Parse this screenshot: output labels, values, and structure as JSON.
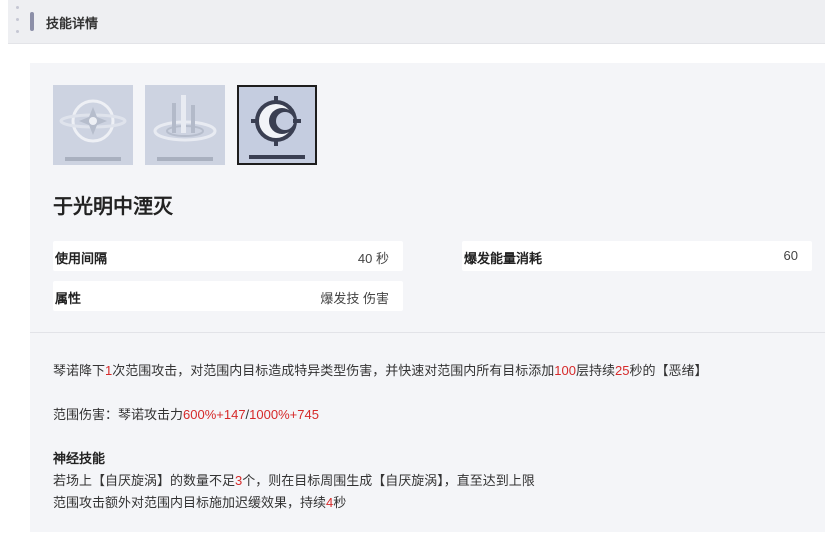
{
  "header": {
    "title": "技能详情"
  },
  "icons": [
    {
      "name": "skill-1-icon",
      "selected": false
    },
    {
      "name": "skill-2-icon",
      "selected": false
    },
    {
      "name": "skill-3-icon",
      "selected": true
    }
  ],
  "skill": {
    "name": "于光明中湮灭",
    "stats": {
      "interval_label": "使用间隔",
      "interval_value": "40 秒",
      "energy_label": "爆发能量消耗",
      "energy_value": "60",
      "attr_label": "属性",
      "attr_value": "爆发技 伤害"
    },
    "description": {
      "line1": {
        "p1": "琴诺降下",
        "n1": "1",
        "p2": "次范围攻击，对范围内目标造成特异类型伤害，并快速对范围内所有目标添加",
        "n2": "100",
        "p3": "层持续",
        "n3": "25",
        "p4": "秒的【恶绪】"
      },
      "line2": {
        "p1": "范围伤害：琴诺攻击力",
        "n1": "600%+147",
        "p2": "/",
        "n2": "1000%+745"
      },
      "neural_title": "神经技能",
      "line3": {
        "p1": "若场上【自厌旋涡】的数量不足",
        "n1": "3",
        "p2": "个，则在目标周围生成【自厌旋涡】，直至达到上限"
      },
      "line4": {
        "p1": "范围攻击额外对范围内目标施加迟缓效果，持续",
        "n1": "4",
        "p2": "秒"
      }
    }
  },
  "colors": {
    "highlight": "#d62a2a",
    "panel_bg": "#f4f5f8",
    "header_bg": "#eeeff2"
  }
}
